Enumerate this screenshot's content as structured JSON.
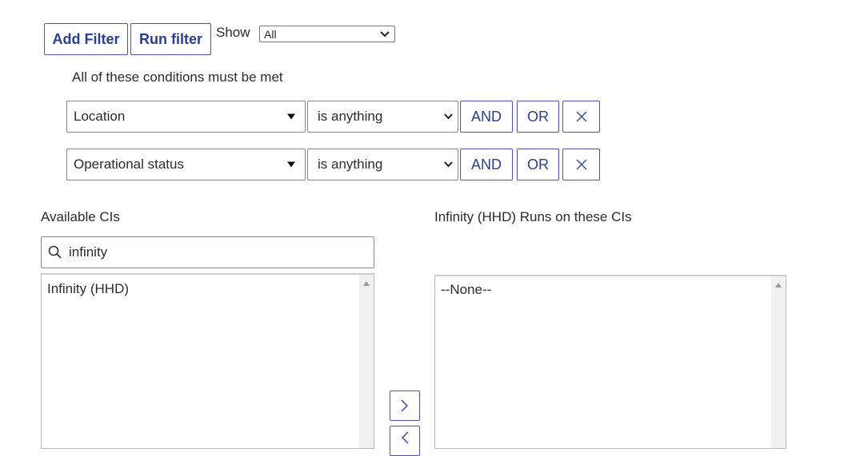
{
  "toolbar": {
    "add_filter": "Add Filter",
    "run_filter": "Run filter",
    "show_label": "Show",
    "show_value": "All"
  },
  "conditions": {
    "heading": "All of these conditions must be met",
    "rows": [
      {
        "field": "Location",
        "operator": "is anything",
        "and": "AND",
        "or": "OR"
      },
      {
        "field": "Operational status",
        "operator": "is anything",
        "and": "AND",
        "or": "OR"
      }
    ]
  },
  "available": {
    "label": "Available CIs",
    "search_value": "infinity",
    "items": [
      "Infinity (HHD)"
    ]
  },
  "selected": {
    "label": "Infinity (HHD) Runs on these CIs",
    "items": [
      "--None--"
    ]
  },
  "colors": {
    "accent": "#293e9a",
    "border": "#4f52a8"
  },
  "icons": {
    "search": "search-icon",
    "remove": "close-icon",
    "move_right": "chevron-right-icon",
    "move_left": "chevron-left-icon"
  }
}
